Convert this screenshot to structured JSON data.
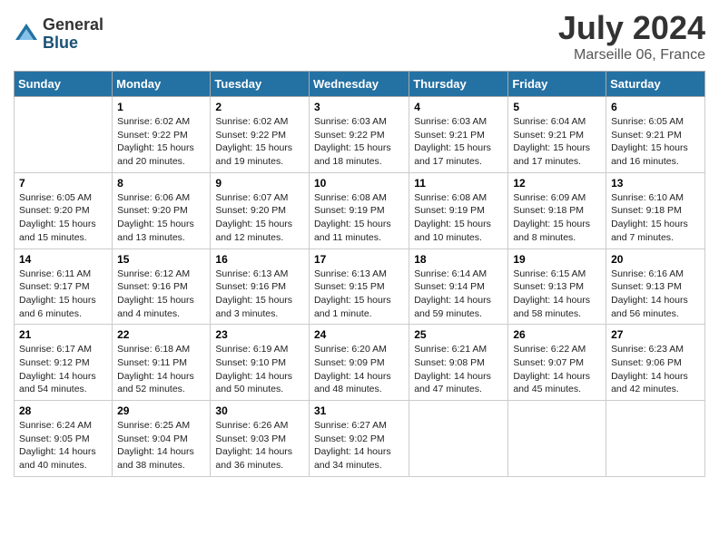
{
  "logo": {
    "general": "General",
    "blue": "Blue"
  },
  "title": "July 2024",
  "location": "Marseille 06, France",
  "days_of_week": [
    "Sunday",
    "Monday",
    "Tuesday",
    "Wednesday",
    "Thursday",
    "Friday",
    "Saturday"
  ],
  "weeks": [
    [
      {
        "day": "",
        "info": ""
      },
      {
        "day": "1",
        "info": "Sunrise: 6:02 AM\nSunset: 9:22 PM\nDaylight: 15 hours\nand 20 minutes."
      },
      {
        "day": "2",
        "info": "Sunrise: 6:02 AM\nSunset: 9:22 PM\nDaylight: 15 hours\nand 19 minutes."
      },
      {
        "day": "3",
        "info": "Sunrise: 6:03 AM\nSunset: 9:22 PM\nDaylight: 15 hours\nand 18 minutes."
      },
      {
        "day": "4",
        "info": "Sunrise: 6:03 AM\nSunset: 9:21 PM\nDaylight: 15 hours\nand 17 minutes."
      },
      {
        "day": "5",
        "info": "Sunrise: 6:04 AM\nSunset: 9:21 PM\nDaylight: 15 hours\nand 17 minutes."
      },
      {
        "day": "6",
        "info": "Sunrise: 6:05 AM\nSunset: 9:21 PM\nDaylight: 15 hours\nand 16 minutes."
      }
    ],
    [
      {
        "day": "7",
        "info": "Sunrise: 6:05 AM\nSunset: 9:20 PM\nDaylight: 15 hours\nand 15 minutes."
      },
      {
        "day": "8",
        "info": "Sunrise: 6:06 AM\nSunset: 9:20 PM\nDaylight: 15 hours\nand 13 minutes."
      },
      {
        "day": "9",
        "info": "Sunrise: 6:07 AM\nSunset: 9:20 PM\nDaylight: 15 hours\nand 12 minutes."
      },
      {
        "day": "10",
        "info": "Sunrise: 6:08 AM\nSunset: 9:19 PM\nDaylight: 15 hours\nand 11 minutes."
      },
      {
        "day": "11",
        "info": "Sunrise: 6:08 AM\nSunset: 9:19 PM\nDaylight: 15 hours\nand 10 minutes."
      },
      {
        "day": "12",
        "info": "Sunrise: 6:09 AM\nSunset: 9:18 PM\nDaylight: 15 hours\nand 8 minutes."
      },
      {
        "day": "13",
        "info": "Sunrise: 6:10 AM\nSunset: 9:18 PM\nDaylight: 15 hours\nand 7 minutes."
      }
    ],
    [
      {
        "day": "14",
        "info": "Sunrise: 6:11 AM\nSunset: 9:17 PM\nDaylight: 15 hours\nand 6 minutes."
      },
      {
        "day": "15",
        "info": "Sunrise: 6:12 AM\nSunset: 9:16 PM\nDaylight: 15 hours\nand 4 minutes."
      },
      {
        "day": "16",
        "info": "Sunrise: 6:13 AM\nSunset: 9:16 PM\nDaylight: 15 hours\nand 3 minutes."
      },
      {
        "day": "17",
        "info": "Sunrise: 6:13 AM\nSunset: 9:15 PM\nDaylight: 15 hours\nand 1 minute."
      },
      {
        "day": "18",
        "info": "Sunrise: 6:14 AM\nSunset: 9:14 PM\nDaylight: 14 hours\nand 59 minutes."
      },
      {
        "day": "19",
        "info": "Sunrise: 6:15 AM\nSunset: 9:13 PM\nDaylight: 14 hours\nand 58 minutes."
      },
      {
        "day": "20",
        "info": "Sunrise: 6:16 AM\nSunset: 9:13 PM\nDaylight: 14 hours\nand 56 minutes."
      }
    ],
    [
      {
        "day": "21",
        "info": "Sunrise: 6:17 AM\nSunset: 9:12 PM\nDaylight: 14 hours\nand 54 minutes."
      },
      {
        "day": "22",
        "info": "Sunrise: 6:18 AM\nSunset: 9:11 PM\nDaylight: 14 hours\nand 52 minutes."
      },
      {
        "day": "23",
        "info": "Sunrise: 6:19 AM\nSunset: 9:10 PM\nDaylight: 14 hours\nand 50 minutes."
      },
      {
        "day": "24",
        "info": "Sunrise: 6:20 AM\nSunset: 9:09 PM\nDaylight: 14 hours\nand 48 minutes."
      },
      {
        "day": "25",
        "info": "Sunrise: 6:21 AM\nSunset: 9:08 PM\nDaylight: 14 hours\nand 47 minutes."
      },
      {
        "day": "26",
        "info": "Sunrise: 6:22 AM\nSunset: 9:07 PM\nDaylight: 14 hours\nand 45 minutes."
      },
      {
        "day": "27",
        "info": "Sunrise: 6:23 AM\nSunset: 9:06 PM\nDaylight: 14 hours\nand 42 minutes."
      }
    ],
    [
      {
        "day": "28",
        "info": "Sunrise: 6:24 AM\nSunset: 9:05 PM\nDaylight: 14 hours\nand 40 minutes."
      },
      {
        "day": "29",
        "info": "Sunrise: 6:25 AM\nSunset: 9:04 PM\nDaylight: 14 hours\nand 38 minutes."
      },
      {
        "day": "30",
        "info": "Sunrise: 6:26 AM\nSunset: 9:03 PM\nDaylight: 14 hours\nand 36 minutes."
      },
      {
        "day": "31",
        "info": "Sunrise: 6:27 AM\nSunset: 9:02 PM\nDaylight: 14 hours\nand 34 minutes."
      },
      {
        "day": "",
        "info": ""
      },
      {
        "day": "",
        "info": ""
      },
      {
        "day": "",
        "info": ""
      }
    ]
  ]
}
